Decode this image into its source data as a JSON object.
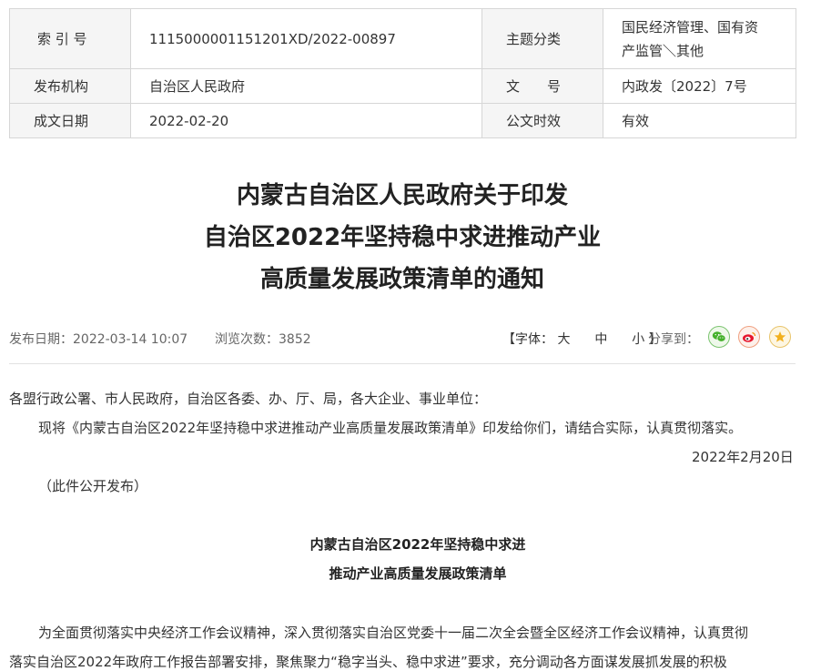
{
  "meta": {
    "index_label": "索 引 号",
    "index_value": "11150000011512​01XD/2022-00897",
    "topic_label": "主题分类",
    "topic_value_line1": "国民经济管理、国有资",
    "topic_value_line2": "产监管＼其他",
    "publisher_label": "发布机构",
    "publisher_value": "自治区人民政府",
    "docno_label": "文　　号",
    "docno_value": "内政发〔2022〕7号",
    "date_label": "成文日期",
    "date_value": "2022-02-20",
    "validity_label": "公文时效",
    "validity_value": "有效"
  },
  "title": {
    "line1": "内蒙古自治区人民政府关于印发",
    "line2": "自治区2022年坚持稳中求进推动产业",
    "line3": "高质量发展政策清单的通知"
  },
  "info": {
    "pub_date": "发布日期：2022-03-14 10:07",
    "views": "浏览次数：3852",
    "font_prefix": "【字体：",
    "font_large": "大",
    "font_medium": "中",
    "font_small": "小",
    "font_suffix": "】",
    "share_label": "分享到："
  },
  "content": {
    "salutation": "各盟行政公署、市人民政府，自治区各委、办、厅、局，各大企业、事业单位：",
    "para1": "现将《内蒙古自治区2022年坚持稳中求进推动产业高质量发展政策清单》印发给你们，请结合实际，认真贯彻落实。",
    "sign_date": "2022年2月20日",
    "note": "（此件公开发布）",
    "sub_title_line1": "内蒙古自治区2022年坚持稳中求进",
    "sub_title_line2": "推动产业高质量发展政策清单",
    "para2_line1": "为全面贯彻落实中央经济工作会议精神，深入贯彻落实自治区党委十一届二次全会暨全区经济工作会议精神，认真贯彻",
    "para2_line2": "落实自治区2022年政府工作报告部署安排，聚焦聚力“稳字当头、稳中求进”要求，充分调动各方面谋发展抓发展的积极"
  }
}
